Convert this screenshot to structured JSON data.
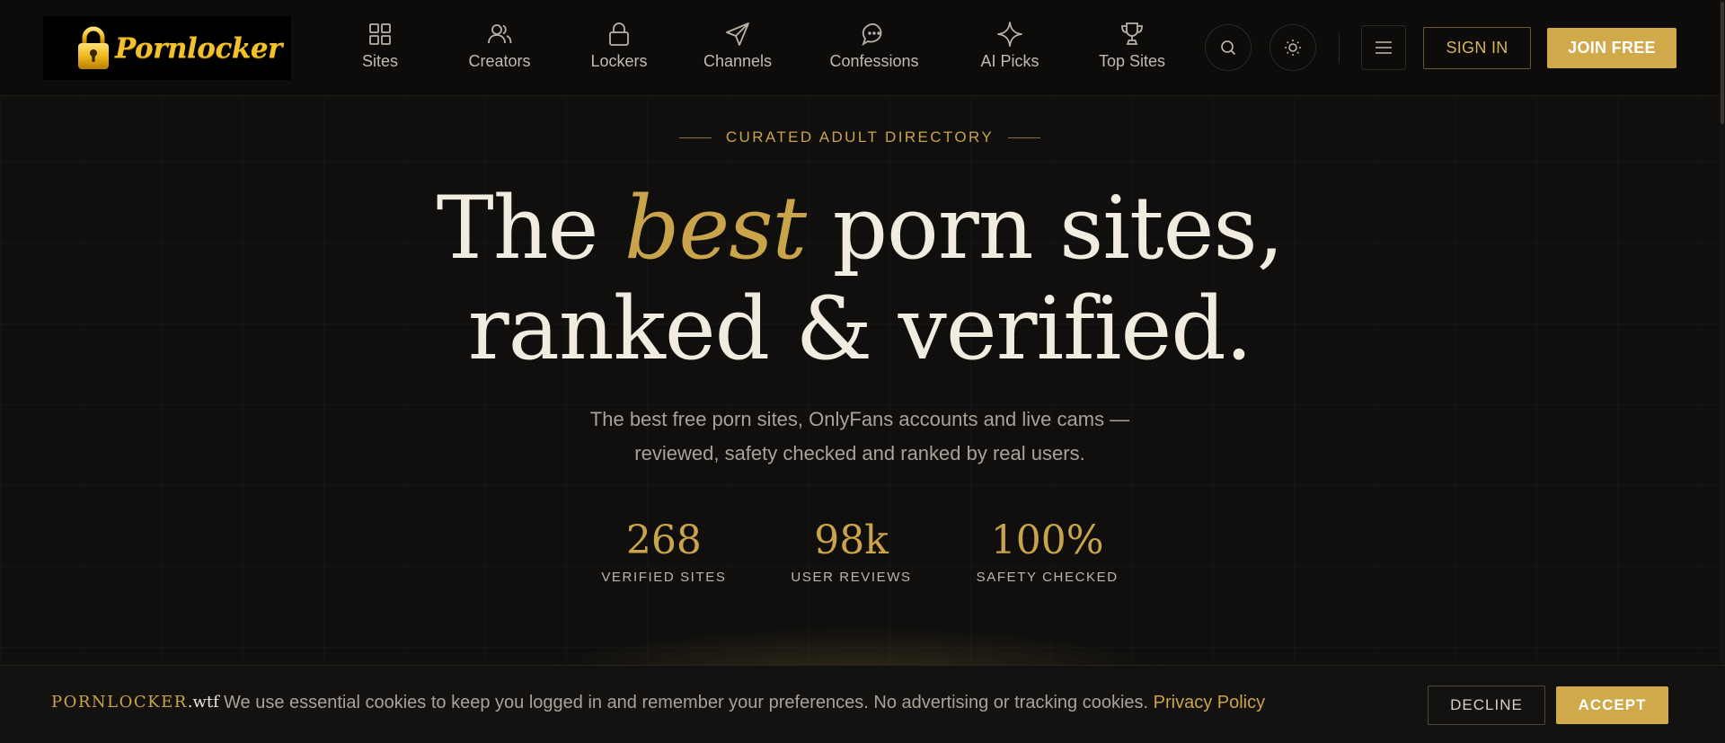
{
  "header": {
    "logo_text": "Pornlocker",
    "nav": [
      {
        "label": "Sites",
        "icon": "grid-icon"
      },
      {
        "label": "Creators",
        "icon": "users-icon"
      },
      {
        "label": "Lockers",
        "icon": "lock-icon"
      },
      {
        "label": "Channels",
        "icon": "send-icon"
      },
      {
        "label": "Confessions",
        "icon": "chat-bubble-icon"
      },
      {
        "label": "AI Picks",
        "icon": "sparkle-icon"
      },
      {
        "label": "Top Sites",
        "icon": "trophy-icon"
      }
    ],
    "sign_in": "SIGN IN",
    "join_free": "JOIN FREE"
  },
  "hero": {
    "eyebrow": "CURATED ADULT DIRECTORY",
    "title_part1": "The ",
    "title_accent": "best",
    "title_part2": " porn sites,",
    "title_line2": "ranked & verified.",
    "subtitle": "The best free porn sites, OnlyFans accounts and live cams — reviewed, safety checked and ranked by real users.",
    "stats": [
      {
        "value": "268",
        "label": "VERIFIED SITES"
      },
      {
        "value": "98k",
        "label": "USER REVIEWS"
      },
      {
        "value": "100%",
        "label": "SAFETY CHECKED"
      }
    ]
  },
  "cookie": {
    "brand": "PORNLOCKER",
    "brand_tld": ".wtf",
    "text": "We use essential cookies to keep you logged in and remember your preferences. No advertising or tracking cookies.",
    "link": "Privacy Policy",
    "decline": "DECLINE",
    "accept": "ACCEPT"
  },
  "colors": {
    "accent": "#c9a44a",
    "background": "#100f0e",
    "text": "#f1ebe0"
  }
}
